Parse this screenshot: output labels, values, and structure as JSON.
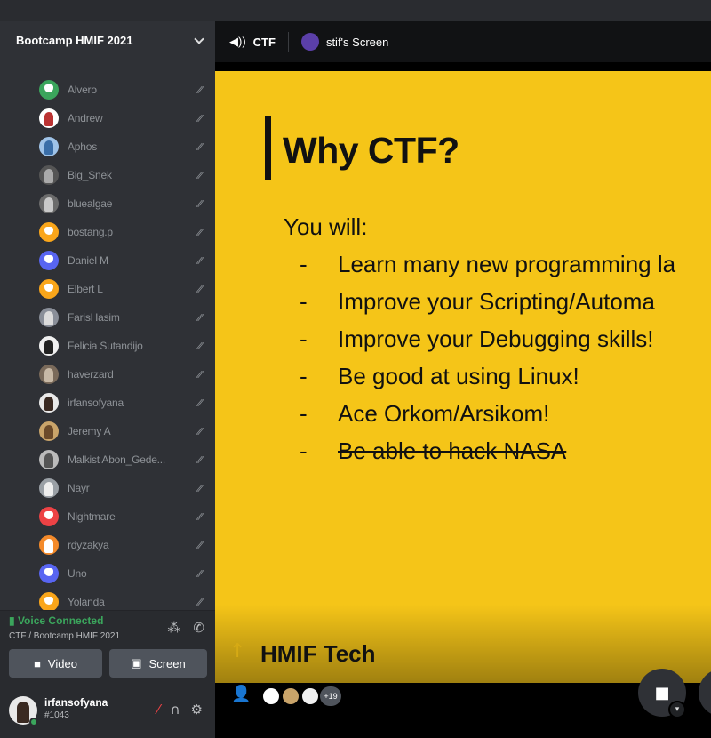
{
  "server": {
    "name": "Bootcamp HMIF 2021"
  },
  "members": [
    {
      "name": "Alvero",
      "color": "#3ba55c",
      "kind": "discord"
    },
    {
      "name": "Andrew",
      "color": "#ffffff",
      "kind": "photo",
      "accent": "#b33"
    },
    {
      "name": "Aphos",
      "color": "#9fc3e8",
      "kind": "photo",
      "accent": "#3a6ea8"
    },
    {
      "name": "Big_Snek",
      "color": "#555",
      "kind": "photo",
      "accent": "#aaa"
    },
    {
      "name": "bluealgae",
      "color": "#6b6b6b",
      "kind": "photo",
      "accent": "#c9c9c9"
    },
    {
      "name": "bostang.p",
      "color": "#faa61a",
      "kind": "discord"
    },
    {
      "name": "Daniel M",
      "color": "#5865f2",
      "kind": "discord"
    },
    {
      "name": "Elbert L",
      "color": "#faa61a",
      "kind": "discord"
    },
    {
      "name": "FarisHasim",
      "color": "#8a8f99",
      "kind": "photo",
      "accent": "#dcdcdc"
    },
    {
      "name": "Felicia Sutandijo",
      "color": "#f0f0f0",
      "kind": "photo",
      "accent": "#222"
    },
    {
      "name": "haverzard",
      "color": "#7a6a5a",
      "kind": "photo",
      "accent": "#c8b9a6"
    },
    {
      "name": "irfansofyana",
      "color": "#e9e9e9",
      "kind": "photo",
      "accent": "#3a2a22"
    },
    {
      "name": "Jeremy A",
      "color": "#c9a46a",
      "kind": "photo",
      "accent": "#6b4a2a"
    },
    {
      "name": "Malkist Abon_Gede...",
      "color": "#bbb",
      "kind": "photo",
      "accent": "#555"
    },
    {
      "name": "Nayr",
      "color": "#9aa0a6",
      "kind": "photo",
      "accent": "#eee"
    },
    {
      "name": "Nightmare",
      "color": "#ed4245",
      "kind": "discord"
    },
    {
      "name": "rdyzakya",
      "color": "#f48a2a",
      "kind": "photo",
      "accent": "#fff"
    },
    {
      "name": "Uno",
      "color": "#5865f2",
      "kind": "discord"
    },
    {
      "name": "Yolanda",
      "color": "#faa61a",
      "kind": "discord"
    }
  ],
  "voice": {
    "status": "Voice Connected",
    "channel_path": "CTF / Bootcamp HMIF 2021",
    "video_label": "Video",
    "screen_label": "Screen"
  },
  "user": {
    "name": "irfansofyana",
    "tag": "#1043"
  },
  "main": {
    "channel": "CTF",
    "screen_owner": "stif's Screen"
  },
  "slide": {
    "title": "Why CTF?",
    "intro": "You will:",
    "bullets": [
      {
        "text": "Learn many new programming la",
        "strike": false
      },
      {
        "text": "Improve your Scripting/Automa",
        "strike": false
      },
      {
        "text": "Improve your Debugging skills!",
        "strike": false
      },
      {
        "text": "Be good at using Linux!",
        "strike": false
      },
      {
        "text": "Ace Orkom/Arsikom!",
        "strike": false
      },
      {
        "text": "Be able to hack NASA",
        "strike": true
      }
    ],
    "footer": "HMIF Tech"
  },
  "participants": {
    "extra_count": "+19"
  }
}
